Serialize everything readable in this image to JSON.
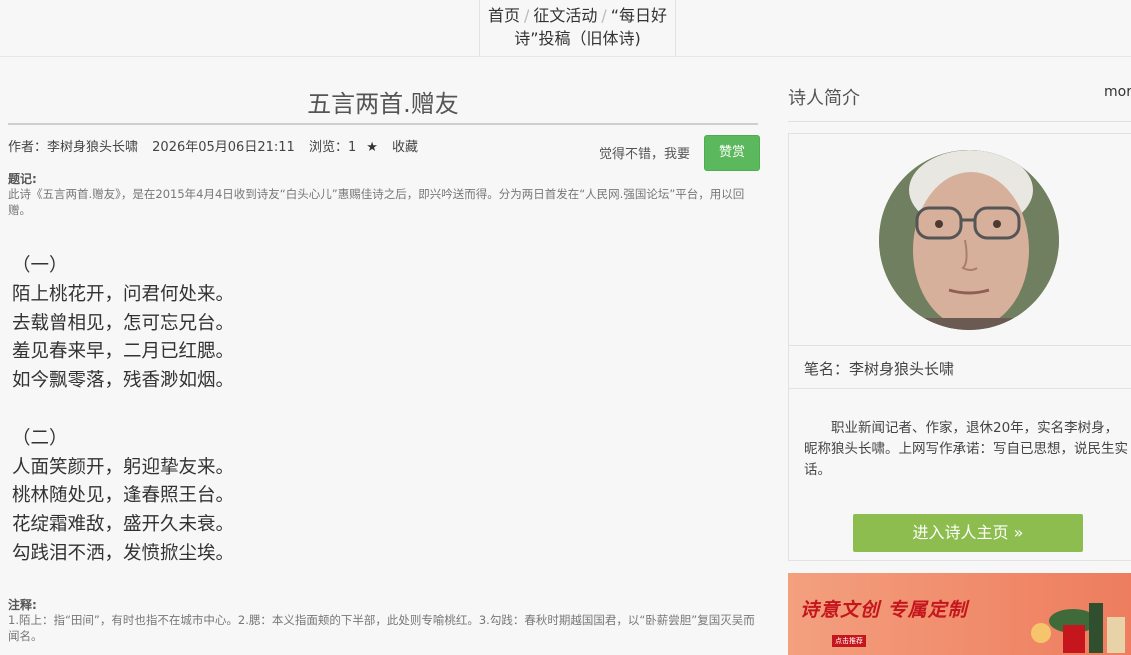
{
  "breadcrumb": {
    "home": "首页",
    "sep": "/",
    "activity": "征文活动",
    "current": "“每日好诗”投稿（旧体诗)"
  },
  "article": {
    "title": "五言两首.赠友",
    "author": "作者：李树身狼头长啸",
    "datetime": "2026年05月06日21:11",
    "views": "浏览：1",
    "star_icon": "star-icon",
    "favorite": "收藏",
    "like_text": "觉得不错，我要",
    "reward_button": "赞赏",
    "tiji_label": "题记:",
    "tiji_text": "此诗《五言两首.赠友》，是在2015年4月4日收到诗友“白头心儿”惠赐佳诗之后，即兴吟送而得。分为两日首发在“人民网.强国论坛”平台，用以回赠。",
    "poem_part1": [
      "（一）",
      "陌上桃花开，问君何处来。",
      "去载曾相见，怎可忘兄台。",
      "羞见春来早，二月已红腮。",
      "如今飘零落，残香渺如烟。"
    ],
    "poem_part2": [
      "（二）",
      "人面笑颜开，躬迎挚友来。",
      "桃林随处见，逢春照王台。",
      "花绽霜难敌，盛开久未衰。",
      "勾践泪不洒，发愤掀尘埃。"
    ],
    "notes_label": "注释:",
    "notes_text": "1.陌上：指“田间”，有时也指不在城市中心。2.腮：本义指面颊的下半部，此处则专喻桃红。3.勾践：春秋时期越国国君，以“卧薪尝胆”复国灭吴而闻名。"
  },
  "sidebar": {
    "heading": "诗人简介",
    "more": "mor",
    "pen_name": "笔名：李树身狼头长啸",
    "bio": "职业新闻记者、作家，退休20年，实名李树身，昵称狼头长啸。上网写作承诺：写自已思想，说民生实话。",
    "home_button": "进入诗人主页 »",
    "banner_text": "诗意文创  专属定制",
    "banner_tag": "点击推荐"
  },
  "colors": {
    "reward_button": "#5cb85c",
    "home_button": "#8cbd4e",
    "banner": "#f08a6a"
  }
}
